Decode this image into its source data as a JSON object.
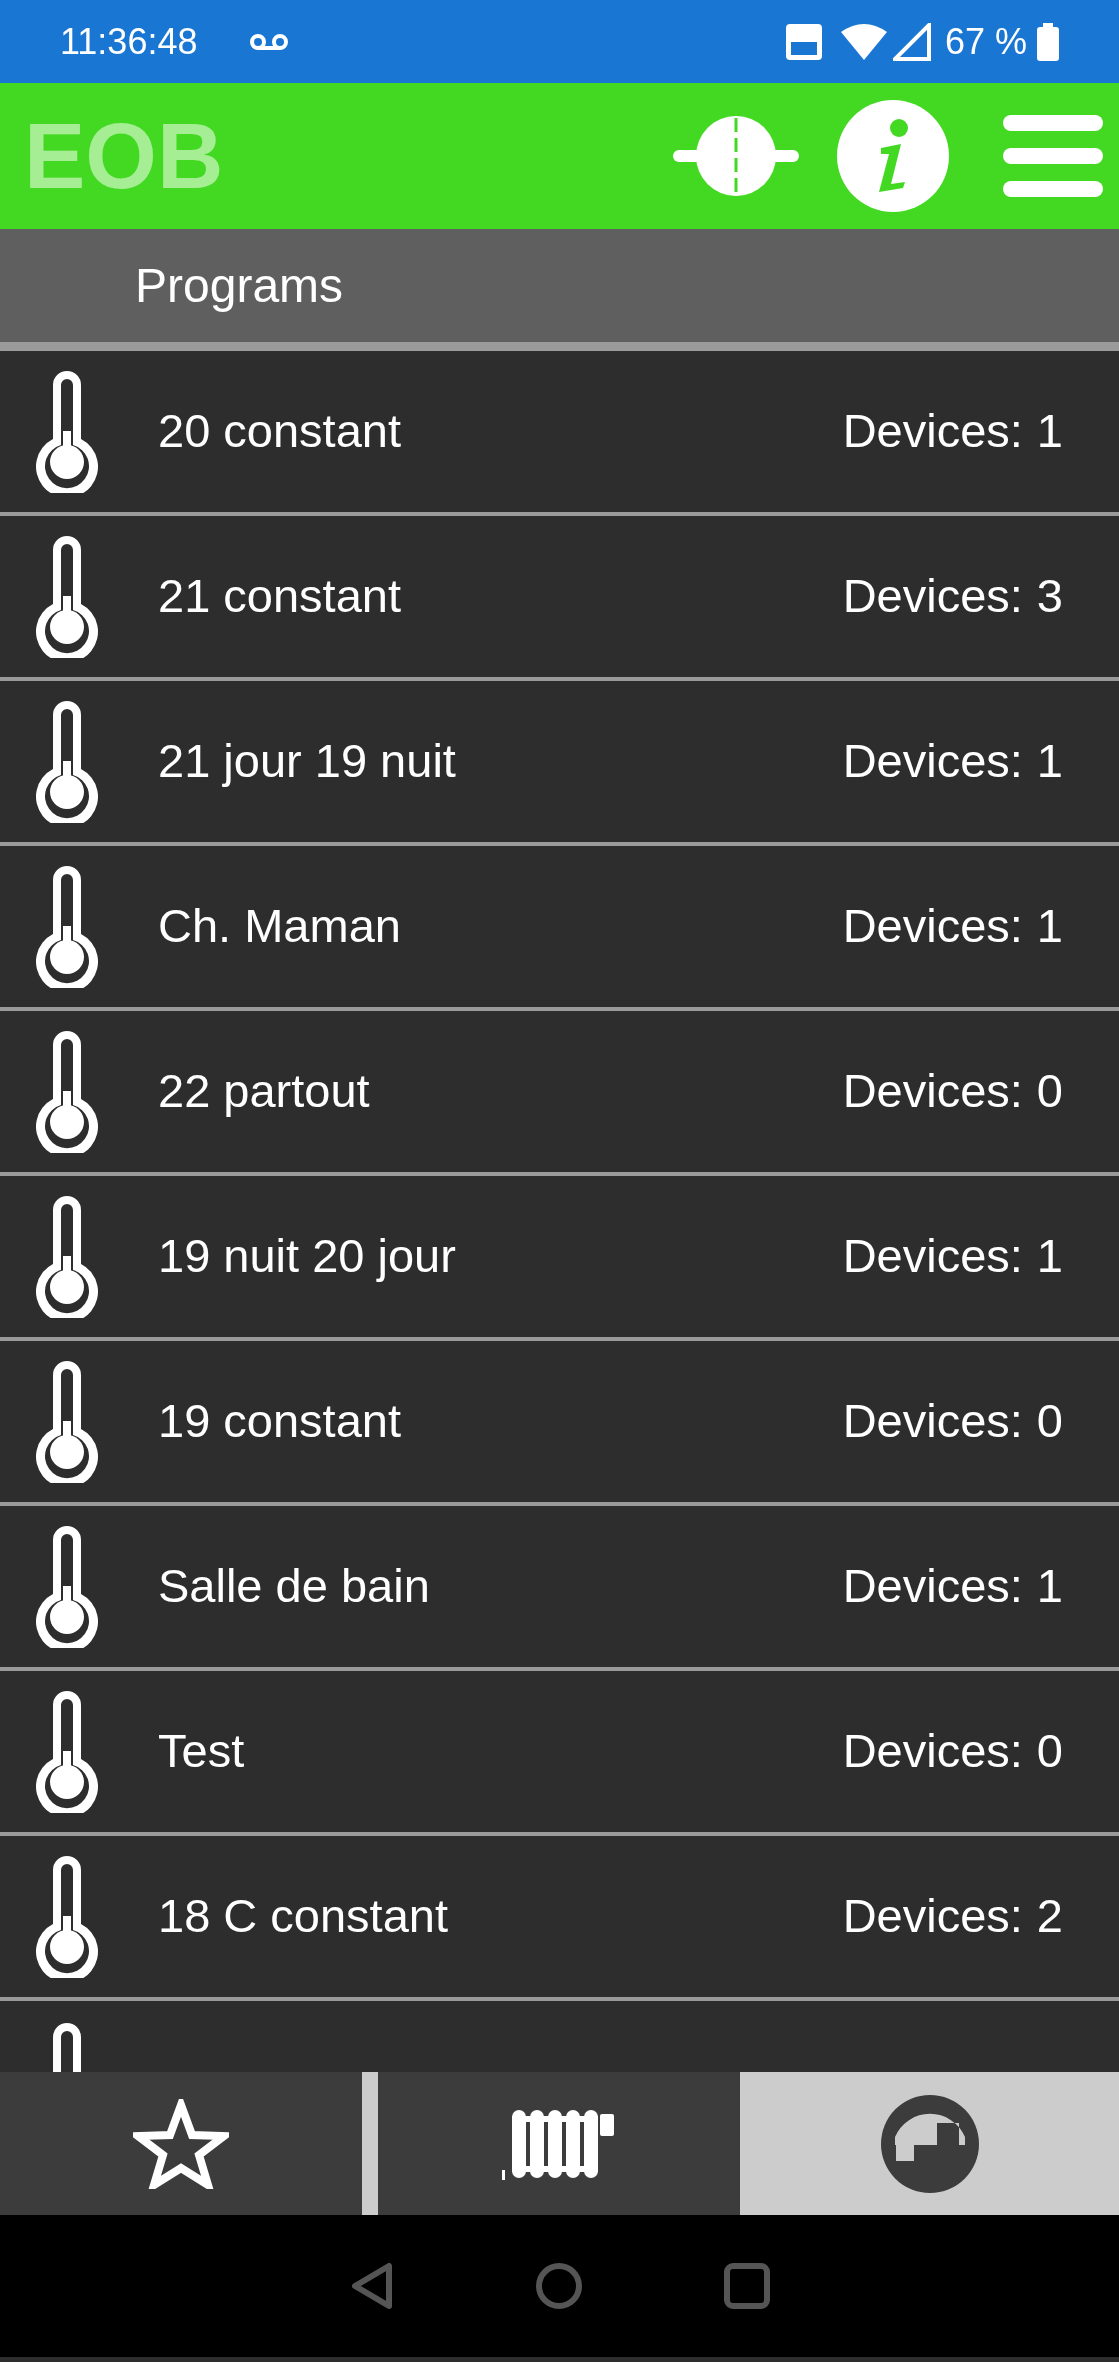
{
  "status_bar": {
    "time": "11:36:48",
    "battery": "67 %"
  },
  "header": {
    "logo": "EOB"
  },
  "page_title": "Programs",
  "programs": [
    {
      "name": "20 constant",
      "devices_label": "Devices:",
      "devices": "1"
    },
    {
      "name": "21 constant",
      "devices_label": "Devices:",
      "devices": "3"
    },
    {
      "name": "21 jour 19 nuit",
      "devices_label": "Devices:",
      "devices": "1"
    },
    {
      "name": "Ch. Maman",
      "devices_label": "Devices:",
      "devices": "1"
    },
    {
      "name": "22 partout",
      "devices_label": "Devices:",
      "devices": "0"
    },
    {
      "name": "19 nuit 20 jour",
      "devices_label": "Devices:",
      "devices": "1"
    },
    {
      "name": "19 constant",
      "devices_label": "Devices:",
      "devices": "0"
    },
    {
      "name": "Salle de bain",
      "devices_label": "Devices:",
      "devices": "1"
    },
    {
      "name": "Test",
      "devices_label": "Devices:",
      "devices": "0"
    },
    {
      "name": "18 C constant",
      "devices_label": "Devices:",
      "devices": "2"
    },
    {
      "kind": "partial"
    }
  ],
  "bottom_tabs": [
    {
      "kind": "favorites",
      "selected": false
    },
    {
      "kind": "devices",
      "selected": false
    },
    {
      "kind": "programs",
      "selected": true
    }
  ]
}
